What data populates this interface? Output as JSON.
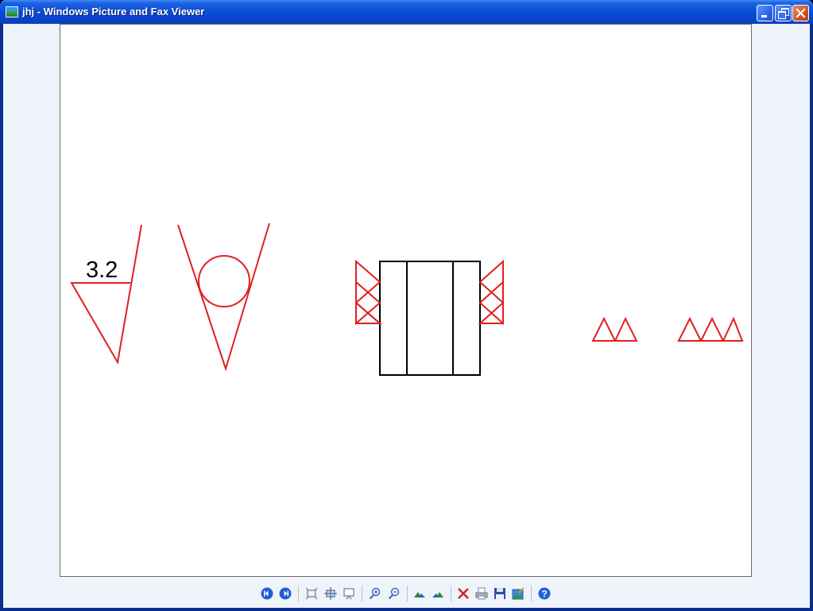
{
  "window": {
    "title": "jhj - Windows Picture and Fax Viewer",
    "icon": "picture-viewer-icon"
  },
  "image": {
    "roughness_value": "3.2"
  },
  "toolbar": {
    "buttons": [
      {
        "name": "previous-image-button",
        "icon": "previous-icon"
      },
      {
        "name": "next-image-button",
        "icon": "next-icon"
      },
      {
        "name": "best-fit-button",
        "icon": "best-fit-icon"
      },
      {
        "name": "actual-size-button",
        "icon": "actual-size-icon"
      },
      {
        "name": "slide-show-button",
        "icon": "slideshow-icon"
      },
      {
        "name": "zoom-in-button",
        "icon": "zoom-in-icon"
      },
      {
        "name": "zoom-out-button",
        "icon": "zoom-out-icon"
      },
      {
        "name": "rotate-clockwise-button",
        "icon": "rotate-clockwise-icon"
      },
      {
        "name": "rotate-counterclockwise-button",
        "icon": "rotate-counterclockwise-icon"
      },
      {
        "name": "delete-button",
        "icon": "delete-icon"
      },
      {
        "name": "print-button",
        "icon": "print-icon"
      },
      {
        "name": "save-button",
        "icon": "save-icon"
      },
      {
        "name": "edit-button",
        "icon": "edit-icon"
      },
      {
        "name": "help-button",
        "icon": "help-icon"
      }
    ]
  },
  "colors": {
    "titlebar": "#0a4fd8",
    "drawing_red": "#e02020",
    "drawing_black": "#000000",
    "client_bg": "#eff3fa"
  }
}
